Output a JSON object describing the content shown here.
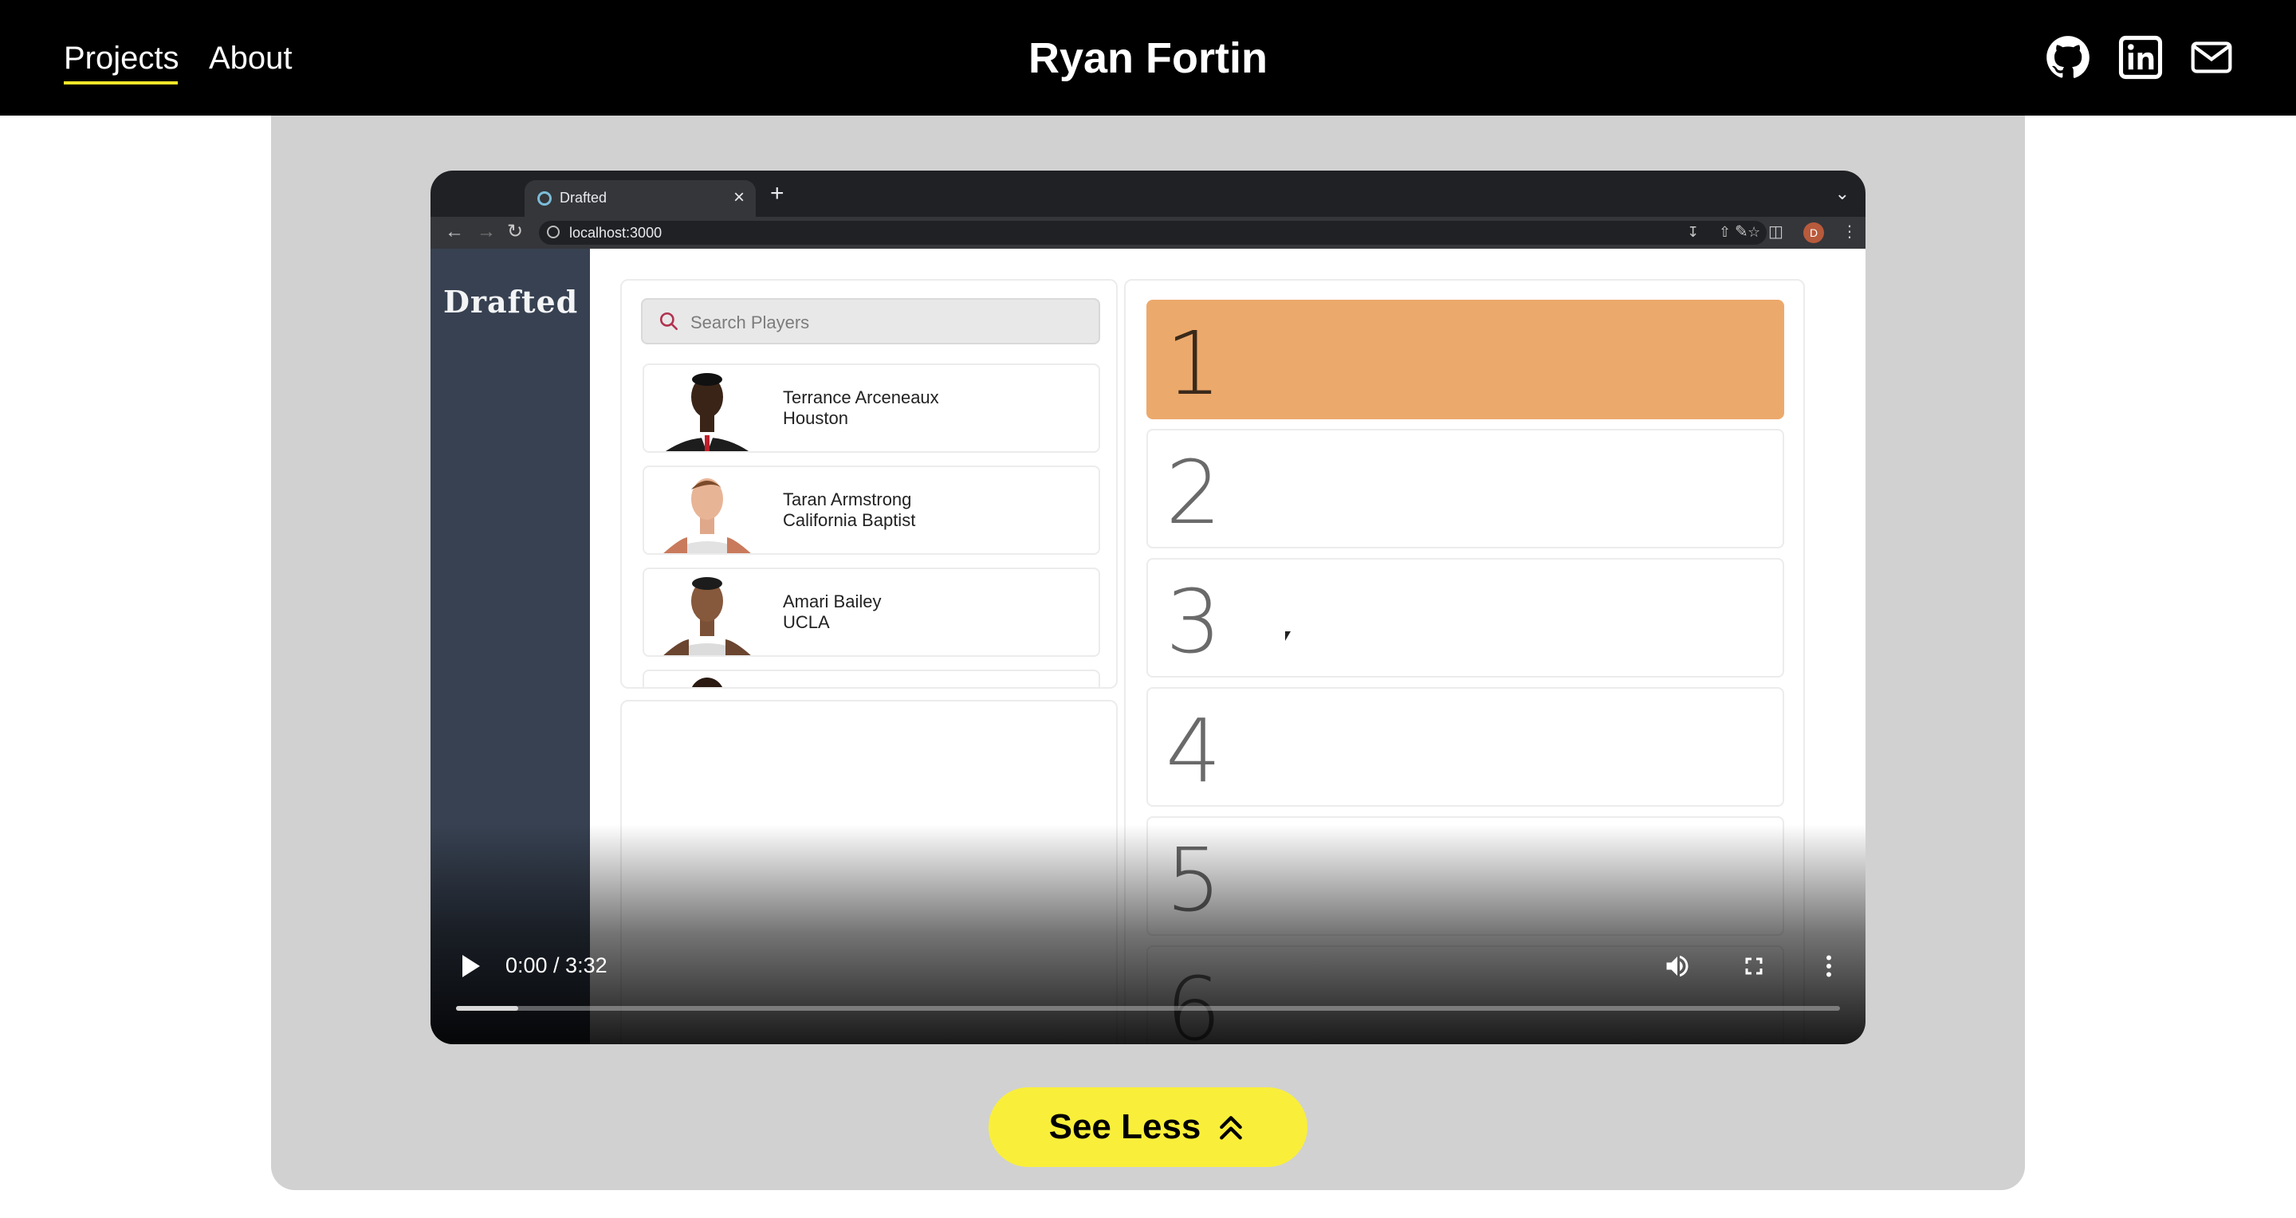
{
  "nav": {
    "links": [
      {
        "label": "Projects",
        "active": true
      },
      {
        "label": "About",
        "active": false
      }
    ],
    "accent": "#f5e62a",
    "title": "Ryan Fortin",
    "social": [
      {
        "icon": "github-icon"
      },
      {
        "icon": "linkedin-icon"
      },
      {
        "icon": "mail-icon"
      }
    ]
  },
  "video": {
    "browser": {
      "tab_title": "Drafted",
      "tab_close": "×",
      "new_tab": "+",
      "url": "localhost:3000",
      "profile_initial": "D"
    },
    "app": {
      "logo": "Drafted",
      "search_placeholder": "Search Players",
      "players": [
        {
          "name": "Terrance Arceneaux",
          "team": "Houston"
        },
        {
          "name": "Taran Armstrong",
          "team": "California Baptist"
        },
        {
          "name": "Amari Bailey",
          "team": "UCLA"
        }
      ],
      "picks": [
        "1",
        "2",
        "3",
        "4",
        "5",
        "6"
      ],
      "active_pick_color": "#eca96c"
    },
    "controls": {
      "time": "0:00 / 3:32",
      "buffered_fraction": 0.045
    }
  },
  "see_less": {
    "label": "See Less",
    "color": "#f9ef3a"
  }
}
